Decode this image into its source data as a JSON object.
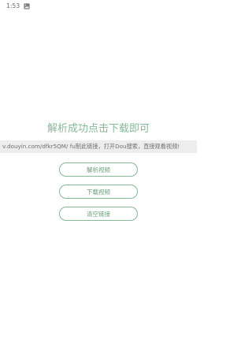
{
  "status_bar": {
    "time": "1:53",
    "icon": "image-icon"
  },
  "main": {
    "headline": "解析成功点击下载即可",
    "link_value": "v.douyin.com/dfkr5QM/ fu制此链接，打开Dou搜索，直接观看视频!"
  },
  "buttons": {
    "parse_label": "解析视频",
    "download_label": "下载视频",
    "clear_label": "清空链接"
  },
  "colors": {
    "accent": "#86b89a",
    "field_background": "#ededed"
  }
}
